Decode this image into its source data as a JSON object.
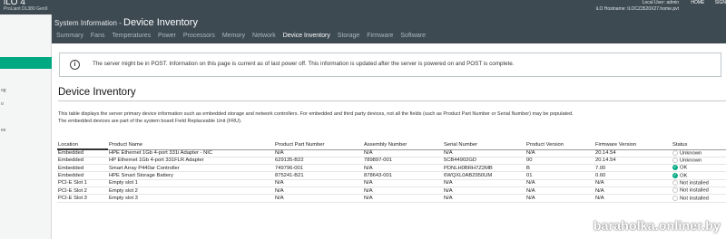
{
  "app": {
    "logo": "iLO 4",
    "server_model": "ProLiant DL380 Gen9",
    "user_line": "Local User: admin",
    "hostname_line": "iLO Hostname: ILOCZ3520X27.home.pvt",
    "links": [
      "HOME",
      "SIGN"
    ]
  },
  "sidebar": {
    "labels": [
      "og",
      "o",
      "es"
    ]
  },
  "header": {
    "section": "System Information",
    "separator": " - ",
    "page": "Device Inventory"
  },
  "tabs": [
    {
      "label": "Summary",
      "active": false
    },
    {
      "label": "Fans",
      "active": false
    },
    {
      "label": "Temperatures",
      "active": false
    },
    {
      "label": "Power",
      "active": false
    },
    {
      "label": "Processors",
      "active": false
    },
    {
      "label": "Memory",
      "active": false
    },
    {
      "label": "Network",
      "active": false
    },
    {
      "label": "Device Inventory",
      "active": true
    },
    {
      "label": "Storage",
      "active": false
    },
    {
      "label": "Firmware",
      "active": false
    },
    {
      "label": "Software",
      "active": false
    }
  ],
  "notice": {
    "icon": "info-icon",
    "text": "The server might be in POST. Information on this page is current as of last power off. This information is updated after the server is powered on and POST is complete."
  },
  "main": {
    "heading": "Device Inventory",
    "desc_line1": "This table displays the server primary device information such as embedded storage and network controllers. For embedded and third party devices, not all the fields (such as Product Part Number or Serial Number) may be populated.",
    "desc_line2": "The embedded devices are part of the system board Field Replaceable Unit (FRU)."
  },
  "table": {
    "columns": [
      "Location",
      "Product Name",
      "Product Part Number",
      "Assembly Number",
      "Serial Number",
      "Product Version",
      "Firmware Version",
      "Status"
    ],
    "rows": [
      [
        "Embedded",
        "HPE Ethernet 1Gb 4-port 331i Adapter - NIC",
        "N/A",
        "N/A",
        "N/A",
        "N/A",
        "20.14.54",
        "Unknown"
      ],
      [
        "Embedded",
        "HP Ethernet 1Gb 4-port 331FLR Adapter",
        "629135-B22",
        "789897-001",
        "5CB44902GD",
        "00",
        "20.14.54",
        "Unknown"
      ],
      [
        "Embedded",
        "Smart Array P440ar Controller",
        "749796-001",
        "N/A",
        "PDNLH0BRH7Z2MB",
        "B",
        "7.00",
        "OK"
      ],
      [
        "Embedded",
        "HPE Smart Storage Battery",
        "875241-B21",
        "878643-001",
        "6WQXL0AB2950UM",
        "01",
        "0.60",
        "OK"
      ],
      [
        "PCI-E Slot 1",
        "Empty slot 1",
        "N/A",
        "N/A",
        "N/A",
        "N/A",
        "N/A",
        "Not installed"
      ],
      [
        "PCI-E Slot 2",
        "Empty slot 2",
        "N/A",
        "N/A",
        "N/A",
        "N/A",
        "N/A",
        "Not installed"
      ],
      [
        "PCI-E Slot 3",
        "Empty slot 3",
        "N/A",
        "N/A",
        "N/A",
        "N/A",
        "N/A",
        "Not installed"
      ]
    ]
  },
  "watermark": "baraholka.onliner.by",
  "colors": {
    "accent": "#01a982",
    "header": "#3d4a52"
  }
}
